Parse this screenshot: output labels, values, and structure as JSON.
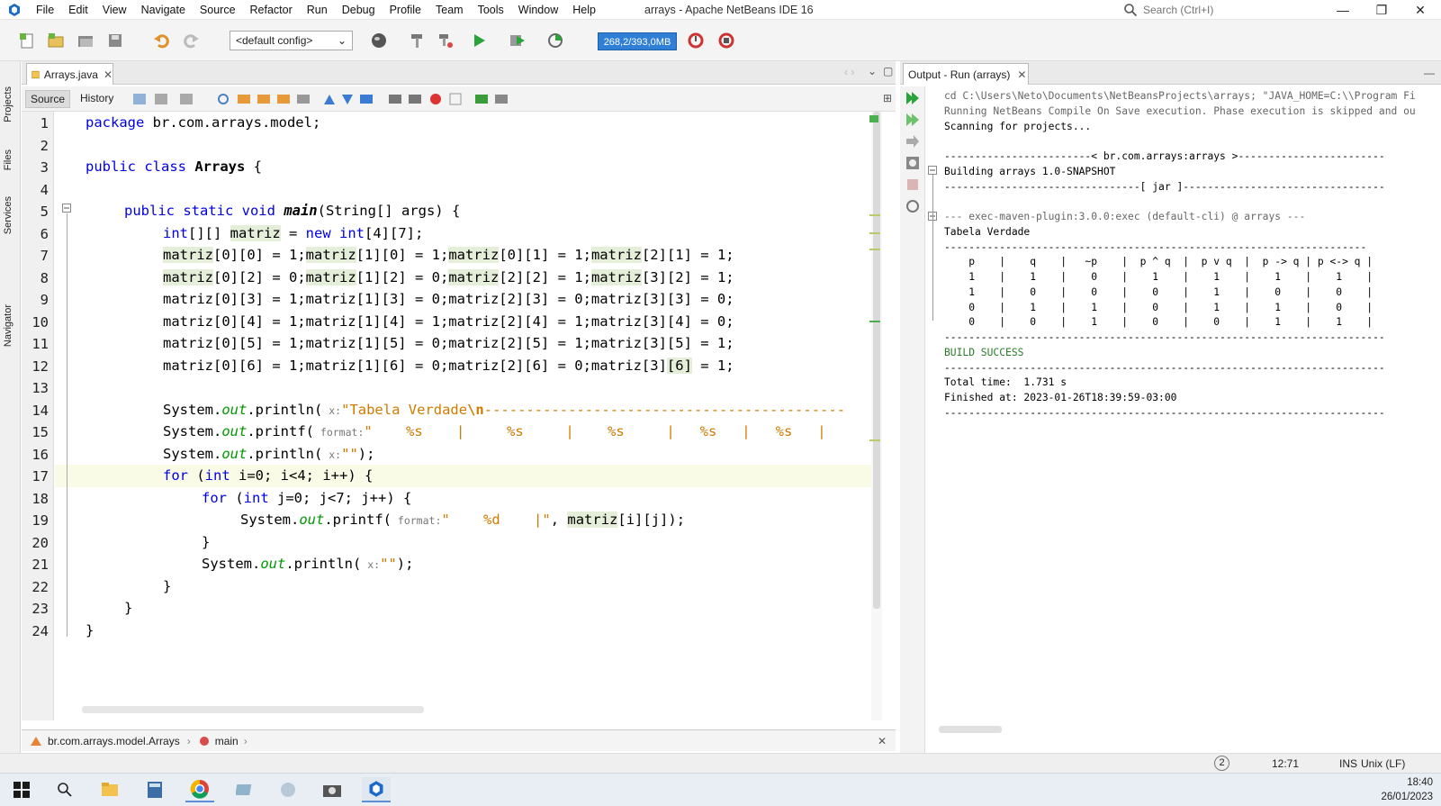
{
  "window": {
    "title": "arrays - Apache NetBeans IDE 16",
    "menu": [
      "File",
      "Edit",
      "View",
      "Navigate",
      "Source",
      "Refactor",
      "Run",
      "Debug",
      "Profile",
      "Team",
      "Tools",
      "Window",
      "Help"
    ],
    "search_placeholder": "Search (Ctrl+I)"
  },
  "toolbar": {
    "config": "<default config>",
    "memory": "268,2/393,0MB"
  },
  "left_strip": [
    "Projects",
    "Files",
    "Services",
    "Navigator"
  ],
  "editor": {
    "tab": "Arrays.java",
    "source_tab": "Source",
    "history_tab": "History",
    "line_numbers": [
      "1",
      "2",
      "3",
      "4",
      "5",
      "6",
      "7",
      "8",
      "9",
      "10",
      "11",
      "12",
      "13",
      "14",
      "15",
      "16",
      "17",
      "18",
      "19",
      "20",
      "21",
      "22",
      "23",
      "24"
    ],
    "lines": {
      "l1a": "package",
      "l1b": " br.com.arrays.model;",
      "l3a": "public class ",
      "l3b": "Arrays",
      " l3c": "",
      "l5a": "public static void ",
      "l5b": "main",
      "l5c": "(String[] args) {",
      "l6a": "int",
      "l6b": "[][] ",
      "l6c": "matriz",
      "l6d": " = ",
      "l6e": "new ",
      "l6f": "int",
      "l6g": "[4][7];",
      "l7": [
        [
          "matriz",
          "[0][0] = 1;"
        ],
        [
          "matriz",
          "[1][0] = 1;"
        ],
        [
          "matriz",
          "[0][1] = 1;"
        ],
        [
          "matriz",
          "[2][1] = 1;"
        ]
      ],
      "l8": [
        [
          "matriz",
          "[0][2] = 0;"
        ],
        [
          "matriz",
          "[1][2] = 0;"
        ],
        [
          "matriz",
          "[2][2] = 1;"
        ],
        [
          "matriz",
          "[3][2] = 1;"
        ]
      ],
      "l9": "matriz[0][3] = 1;matriz[1][3] = 0;matriz[2][3] = 0;matriz[3][3] = 0;",
      "l10": "matriz[0][4] = 1;matriz[1][4] = 1;matriz[2][4] = 1;matriz[3][4] = 0;",
      "l11": "matriz[0][5] = 1;matriz[1][5] = 0;matriz[2][5] = 1;matriz[3][5] = 1;",
      "l12a": "matriz[0][6] = 1;matriz[1][6] = 0;matriz[2][6] = 0;matriz[3]",
      "l12b": "[6]",
      "l12c": " = 1;",
      "l14a": "System.",
      "l14b": "out",
      "l14c": ".println(",
      "l14d": " x:",
      "l14e": "\"Tabela Verdade",
      "l14f": "\\n",
      "l14g": "-------------------------------------------",
      "l15a": "System.",
      "l15b": "out",
      "l15c": ".printf(",
      "l15d": " format:",
      "l15e": "\"    %s    |     %s     |    %s     |   %s   |   %s   |",
      "l16a": "System.",
      "l16b": "out",
      "l16c": ".println(",
      "l16d": " x:",
      "l16e": "\"\"",
      "l16f": ");",
      "l17a": "for ",
      "l17b": "(",
      "l17c": "int",
      " l17d": "",
      "l17e": " i=0; i<4; i++) {",
      "l18a": "for ",
      "l18b": "(",
      "l18c": "int",
      "l18e": " j=0; j<7; j++) {",
      "l19a": "System.",
      "l19b": "out",
      "l19c": ".printf(",
      "l19d": " format:",
      "l19e": "\"    %d    |\"",
      ", l19f": "",
      "l19g": ", ",
      "l19h": "matriz",
      "l19i": "[i][j]);",
      "l20": "}",
      "l21a": "System.",
      "l21b": "out",
      "l21c": ".println(",
      "l21d": " x:",
      "l21e": "\"\"",
      "l21f": ");",
      "l22": "}",
      "l23": "}",
      "l24": "}"
    }
  },
  "breadcrumb": {
    "class": "br.com.arrays.model.Arrays",
    "method": "main"
  },
  "output": {
    "tab": "Output - Run (arrays)",
    "lines": [
      "cd C:\\Users\\Neto\\Documents\\NetBeansProjects\\arrays; \"JAVA_HOME=C:\\\\Program Fi",
      "Running NetBeans Compile On Save execution. Phase execution is skipped and ou",
      "Scanning for projects...",
      "",
      "------------------------< br.com.arrays:arrays >------------------------",
      "Building arrays 1.0-SNAPSHOT",
      "--------------------------------[ jar ]---------------------------------",
      "",
      "--- exec-maven-plugin:3.0.0:exec (default-cli) @ arrays ---",
      "Tabela Verdade",
      "---------------------------------------------------------------------",
      "    p    |    q    |   ~p    |  p ^ q  |  p v q  |  p -> q | p <-> q |",
      "    1    |    1    |    0    |    1    |    1    |    1    |    1    |",
      "    1    |    0    |    0    |    0    |    1    |    0    |    0    |",
      "    0    |    1    |    1    |    0    |    1    |    1    |    0    |",
      "    0    |    0    |    1    |    0    |    0    |    1    |    1    |",
      "------------------------------------------------------------------------",
      "BUILD SUCCESS",
      "------------------------------------------------------------------------",
      "Total time:  1.731 s",
      "Finished at: 2023-01-26T18:39:59-03:00",
      "------------------------------------------------------------------------"
    ]
  },
  "status": {
    "badge": "2",
    "position": "12:71",
    "mode": "INS",
    "eol": "Unix (LF)"
  },
  "taskbar": {
    "time": "18:40",
    "date": "26/01/2023"
  }
}
